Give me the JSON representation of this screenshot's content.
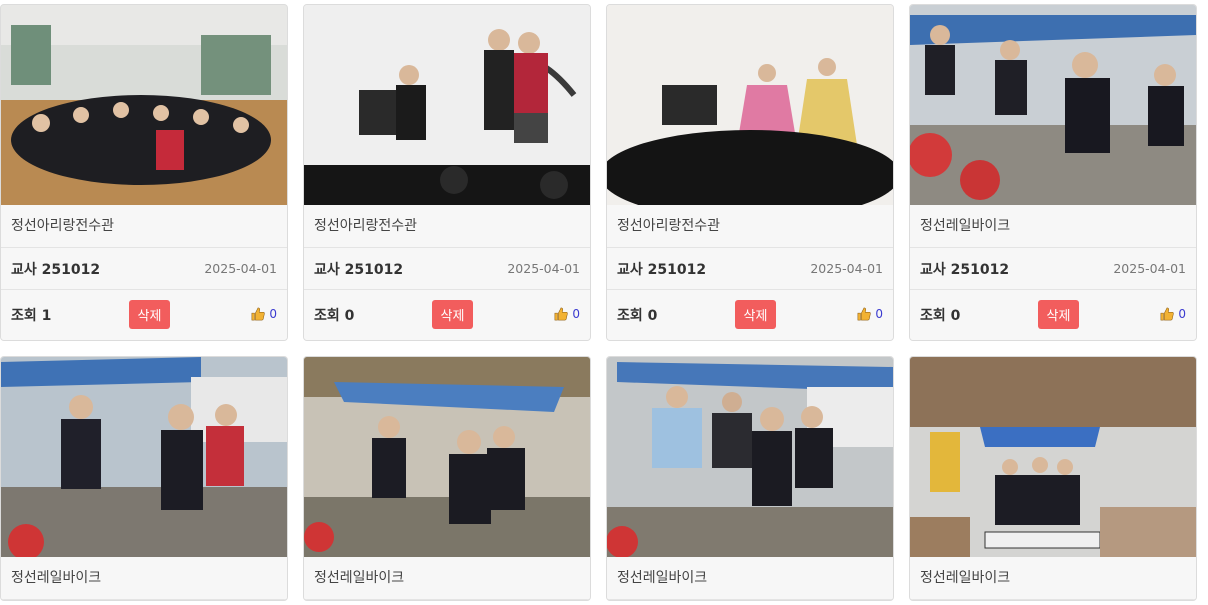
{
  "cards": [
    {
      "place": "정선아리랑전수관",
      "author": "교사 251012",
      "date": "2025-04-01",
      "views": "조회 1",
      "delete_label": "삭제",
      "likes": "0",
      "photo": "hall-group"
    },
    {
      "place": "정선아리랑전수관",
      "author": "교사 251012",
      "date": "2025-04-01",
      "views": "조회 0",
      "delete_label": "삭제",
      "likes": "0",
      "photo": "stage-singers"
    },
    {
      "place": "정선아리랑전수관",
      "author": "교사 251012",
      "date": "2025-04-01",
      "views": "조회 0",
      "delete_label": "삭제",
      "likes": "0",
      "photo": "stage-hanbok"
    },
    {
      "place": "정선레일바이크",
      "author": "교사 251012",
      "date": "2025-04-01",
      "views": "조회 0",
      "delete_label": "삭제",
      "likes": "0",
      "photo": "railbike-1"
    },
    {
      "place": "정선레일바이크",
      "photo": "railbike-2"
    },
    {
      "place": "정선레일바이크",
      "photo": "railbike-3"
    },
    {
      "place": "정선레일바이크",
      "photo": "railbike-4"
    },
    {
      "place": "정선레일바이크",
      "photo": "railbike-5"
    }
  ],
  "colors": {
    "delete": "#f25d5d",
    "like": "#3b3bd0",
    "thumb": "#f2b233"
  },
  "icons": {
    "like": "thumbs-up-icon"
  }
}
